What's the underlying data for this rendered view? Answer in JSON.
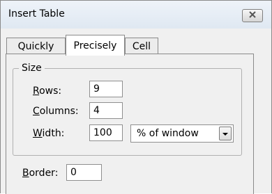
{
  "window": {
    "title": "Insert Table",
    "close_icon": "close-x-icon"
  },
  "tabs": [
    {
      "label": "Quickly",
      "selected": false
    },
    {
      "label": "Precisely",
      "selected": true
    },
    {
      "label": "Cell",
      "selected": false
    }
  ],
  "size_group": {
    "legend": "Size",
    "rows": {
      "label_accel": "R",
      "label_rest": "ows:",
      "value": "9"
    },
    "columns": {
      "label_accel": "C",
      "label_rest": "olumns:",
      "value": "4"
    },
    "width": {
      "label_accel": "W",
      "label_rest": "idth:",
      "value": "100",
      "unit": "% of window",
      "dropdown_icon": "chevron-down-icon"
    }
  },
  "border": {
    "label_accel": "B",
    "label_rest": "order:",
    "value": "0"
  }
}
